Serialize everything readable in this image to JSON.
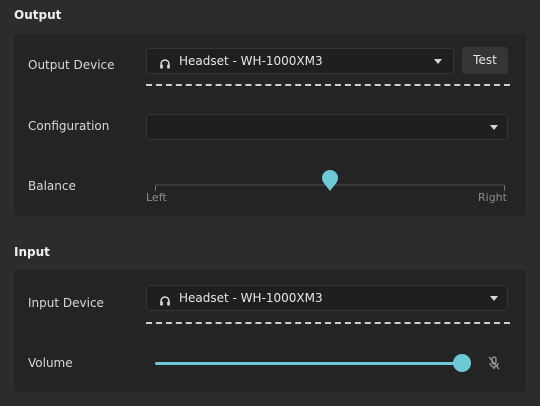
{
  "output": {
    "title": "Output",
    "device_label": "Output Device",
    "device_value": "Headset - WH-1000XM3",
    "test_label": "Test",
    "configuration_label": "Configuration",
    "configuration_value": "",
    "balance_label": "Balance",
    "balance_left": "Left",
    "balance_right": "Right",
    "balance_level": 0.5
  },
  "input": {
    "title": "Input",
    "device_label": "Input Device",
    "device_value": "Headset - WH-1000XM3",
    "volume_label": "Volume",
    "volume_level": 1.0
  },
  "colors": {
    "accent": "#6ec9d6"
  },
  "icons": {
    "device": "headset-icon",
    "dropdown": "chevron-down-icon",
    "mute": "microphone-muted-icon"
  }
}
